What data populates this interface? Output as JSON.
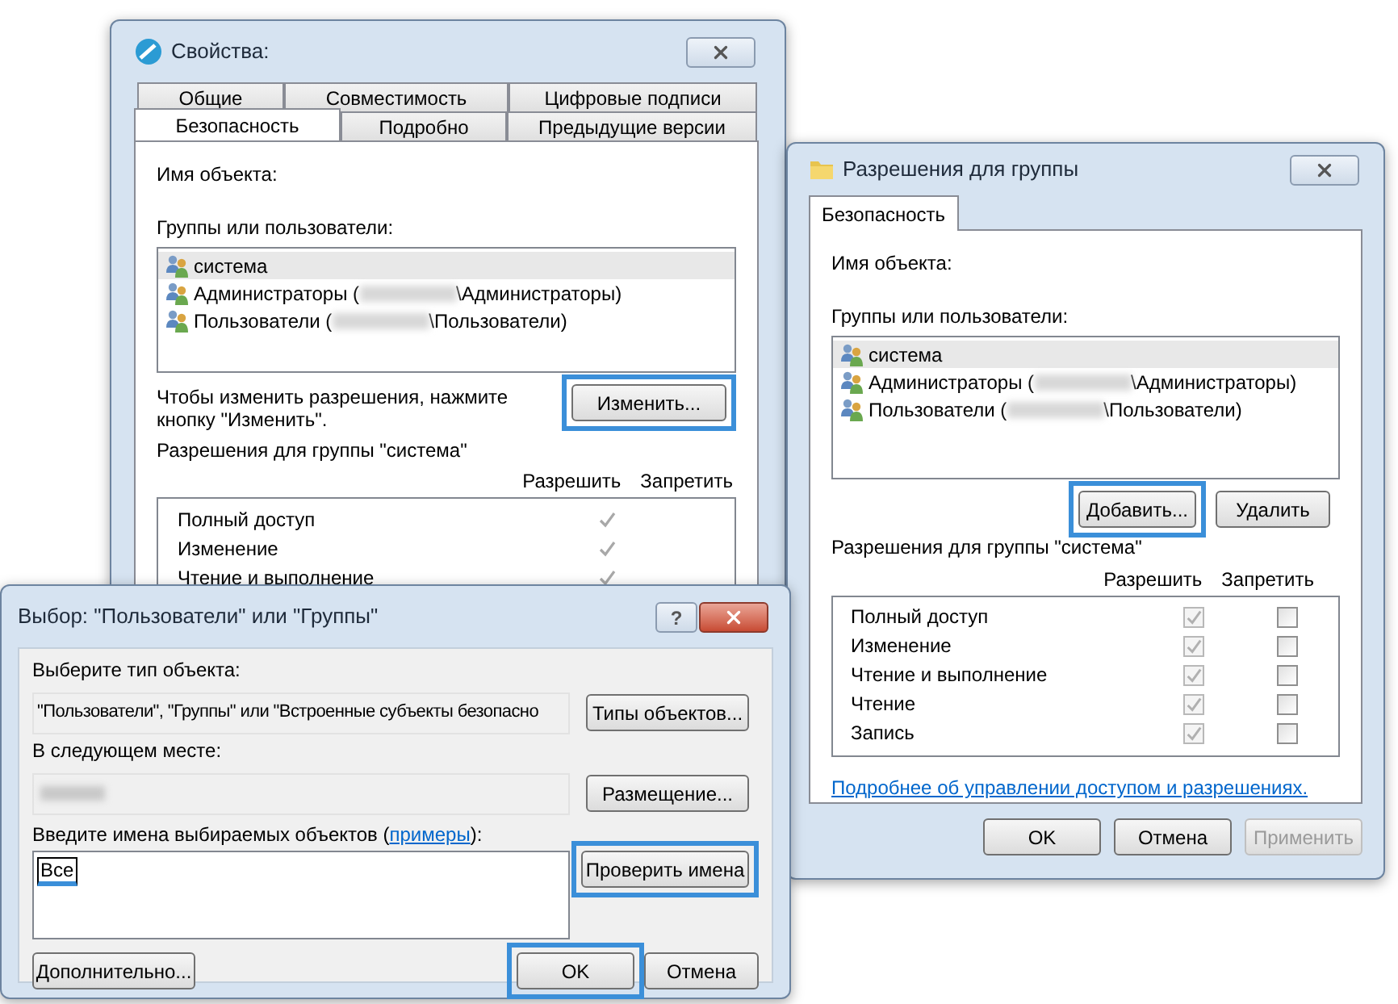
{
  "properties_window": {
    "title": "Свойства:",
    "tab_rows": [
      [
        {
          "label": "Общие",
          "selected": false
        },
        {
          "label": "Совместимость",
          "selected": false
        },
        {
          "label": "Цифровые подписи",
          "selected": false
        }
      ],
      [
        {
          "label": "Безопасность",
          "selected": true
        },
        {
          "label": "Подробно",
          "selected": false
        },
        {
          "label": "Предыдущие версии",
          "selected": false
        }
      ]
    ],
    "object_label": "Имя объекта:",
    "groups_label": "Группы или пользователи:",
    "principals": [
      {
        "prefix": "система",
        "redacted": false,
        "selected": true
      },
      {
        "prefix": "Администраторы (",
        "suffix": "\\Администраторы)",
        "redacted": true,
        "selected": false
      },
      {
        "prefix": "Пользователи (",
        "suffix": "\\Пользователи)",
        "redacted": true,
        "selected": false
      }
    ],
    "hint": "Чтобы изменить разрешения, нажмите кнопку \"Изменить\".",
    "edit_button": {
      "label": "Изменить...",
      "highlighted": true
    },
    "permissions_label": "Разрешения для группы \"система\"",
    "columns": [
      "Разрешить",
      "Запретить"
    ],
    "permissions": [
      {
        "name": "Полный доступ",
        "allow": true
      },
      {
        "name": "Изменение",
        "allow": true
      },
      {
        "name": "Чтение и выполнение",
        "allow": true
      }
    ]
  },
  "group_window": {
    "title": "Разрешения для группы",
    "tabs": [
      {
        "label": "Безопасность",
        "selected": true
      }
    ],
    "object_label": "Имя объекта:",
    "groups_label": "Группы или пользователи:",
    "principals": [
      {
        "prefix": "система",
        "redacted": false,
        "selected": true
      },
      {
        "prefix": "Администраторы (",
        "suffix": "\\Администраторы)",
        "redacted": true,
        "selected": false
      },
      {
        "prefix": "Пользователи (",
        "suffix": "\\Пользователи)",
        "redacted": true,
        "selected": false
      }
    ],
    "list_buttons": [
      {
        "label": "Добавить...",
        "highlighted": true
      },
      {
        "label": "Удалить",
        "highlighted": false
      }
    ],
    "permissions_label": "Разрешения для группы \"система\"",
    "columns": [
      "Разрешить",
      "Запретить"
    ],
    "permissions": [
      {
        "name": "Полный доступ",
        "allow": true,
        "deny": false
      },
      {
        "name": "Изменение",
        "allow": true,
        "deny": false
      },
      {
        "name": "Чтение и выполнение",
        "allow": true,
        "deny": false
      },
      {
        "name": "Чтение",
        "allow": true,
        "deny": false
      },
      {
        "name": "Запись",
        "allow": true,
        "deny": false
      }
    ],
    "link": "Подробнее об управлении доступом и разрешениях.",
    "footer_buttons": [
      {
        "label": "OK",
        "disabled": false
      },
      {
        "label": "Отмена",
        "disabled": false
      },
      {
        "label": "Применить",
        "disabled": true
      }
    ]
  },
  "select_window": {
    "title": "Выбор: \"Пользователи\" или \"Группы\"",
    "help_button": "?",
    "type_label": "Выберите тип объекта:",
    "type_value": "\"Пользователи\", \"Группы\" или \"Встроенные субъекты безопасно",
    "type_button": {
      "label": "Типы объектов...",
      "highlighted": false
    },
    "location_label": "В следующем месте:",
    "location_redacted": true,
    "location_button": {
      "label": "Размещение...",
      "highlighted": false
    },
    "names_label": {
      "before": "Введите имена выбираемых объектов (",
      "link": "примеры",
      "after": "):"
    },
    "names_value": "Все",
    "names_value_highlighted": true,
    "check_button": {
      "label": "Проверить имена",
      "highlighted": true
    },
    "advanced_button": {
      "label": "Дополнительно...",
      "highlighted": false
    },
    "ok_button": {
      "label": "OK",
      "highlighted": true
    },
    "cancel_button": {
      "label": "Отмена",
      "highlighted": false
    }
  }
}
